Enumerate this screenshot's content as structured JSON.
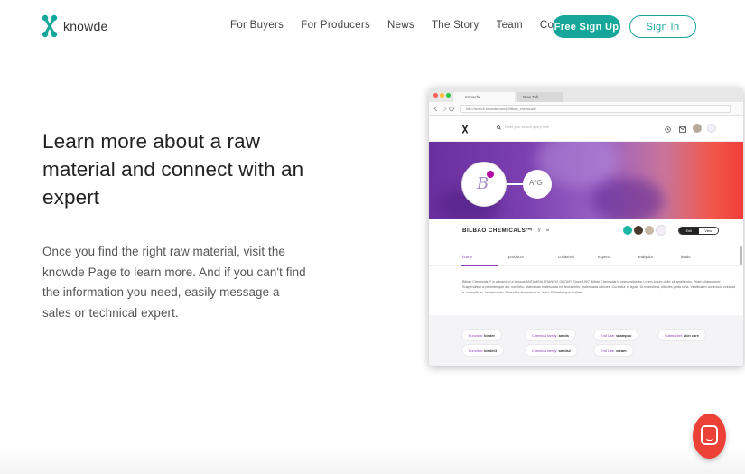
{
  "brand": {
    "name": "knowde",
    "color": "#16a79a"
  },
  "nav": {
    "links": [
      "For Buyers",
      "For Producers",
      "News",
      "The Story",
      "Team",
      "Contact"
    ],
    "signup_label": "Free Sign Up",
    "signin_label": "Sign In"
  },
  "hero": {
    "title": "Learn more about a raw material and connect with an expert",
    "body": "Once you find the right raw material, visit the knowde Page to learn more. And if you can't find the information you need, easily message a sales or technical expert."
  },
  "mockup": {
    "tab_active": "Knowde",
    "tab_inactive": "New Tab",
    "url": "http://search.knowde.com/p/bilbao_chemicals/",
    "search_placeholder": "Enter your search query here",
    "logo_letter": "B",
    "partner_label": "A/G",
    "company_name": "BILBAO CHEMICALS™",
    "social": [
      "f",
      "y",
      "in"
    ],
    "edit_label": "Edit",
    "view_label": "View",
    "subnav": [
      "home",
      "products",
      "collateral",
      "experts",
      "analytics",
      "leads"
    ],
    "description": "Bilbao Chemicals™ is a brand of a famous ANTAMINA FRANCIS GROUP. Since 1997 Bilbao Chemicals is responsible for Lorem ipsum dolor sit amet enim. Etiam ullamcorper. Suspendisse a pellentesque dui, non felis. Maecenas malesuada elit lectus felis, malesuada ultricies. Curabitur et ligula. Ut molestie a, ultricies porta urna. Vestibulum commodo volutpat a, convallis ac, laoreet enim. Phasellus fermentum in, dolor. Pellentesque facilisis.",
    "pills_row1": [
      {
        "key": "Function:",
        "value": "binder"
      },
      {
        "key": "Chemical family:",
        "value": "amids"
      },
      {
        "key": "End Use:",
        "value": "shampoo"
      },
      {
        "key": "Submarket:",
        "value": "skin care"
      }
    ],
    "pills_row2": [
      {
        "key": "Function:",
        "value": "binder3"
      },
      {
        "key": "Chemical family:",
        "value": "amids2"
      },
      {
        "key": "End Use:",
        "value": "cream"
      }
    ]
  },
  "chat": {
    "icon": "chat-icon",
    "color": "#ed4036"
  }
}
